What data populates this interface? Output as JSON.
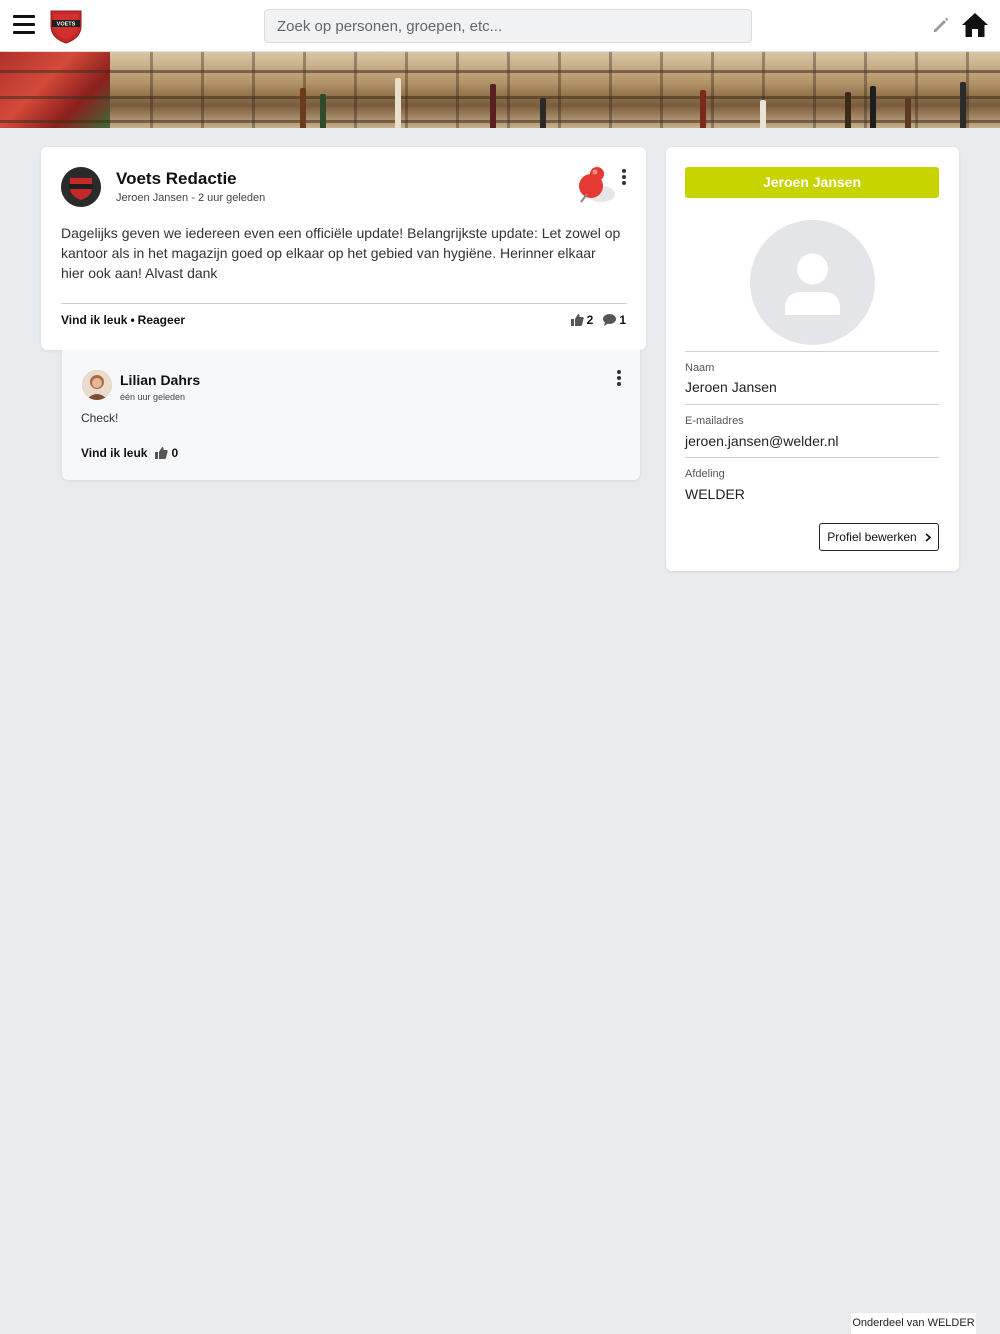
{
  "topbar": {
    "search_placeholder": "Zoek op personen, groepen, etc...",
    "logo_text": "VOETS"
  },
  "post": {
    "author_title": "Voets Redactie",
    "author_name": "Jeroen Jansen",
    "separator": " - ",
    "time": "2 uur geleden",
    "body": "Dagelijks geven we iedereen even een officiële update! Belangrijkste update: Let zowel op kantoor als in het magazijn goed op elkaar op het gebied van hygiëne. Herinner elkaar hier ook aan! Alvast dank",
    "like_label": "Vind ik leuk",
    "dot": "•",
    "reply_label": "Reageer",
    "likes": "2",
    "comments": "1"
  },
  "comment": {
    "name": "Lilian Dahrs",
    "time": "één uur geleden",
    "text": "Check!",
    "like_label": "Vind ik leuk",
    "likes": "0"
  },
  "profile": {
    "header_name": "Jeroen Jansen",
    "name_label": "Naam",
    "name_value": "Jeroen Jansen",
    "email_label": "E-mailadres",
    "email_value": "jeroen.jansen@welder.nl",
    "dept_label": "Afdeling",
    "dept_value": "WELDER",
    "edit_button": "Profiel bewerken"
  },
  "footer": {
    "tag": "Onderdeel van WELDER"
  },
  "colors": {
    "accent": "#c7d400",
    "background": "#e8ebee",
    "logo_red": "#c62828"
  },
  "icons": [
    "menu-icon",
    "logo-icon",
    "pencil-icon",
    "home-icon",
    "pin-icon",
    "more-icon",
    "thumbs-up-icon",
    "comment-icon",
    "user-placeholder-icon",
    "chevron-right-icon"
  ]
}
